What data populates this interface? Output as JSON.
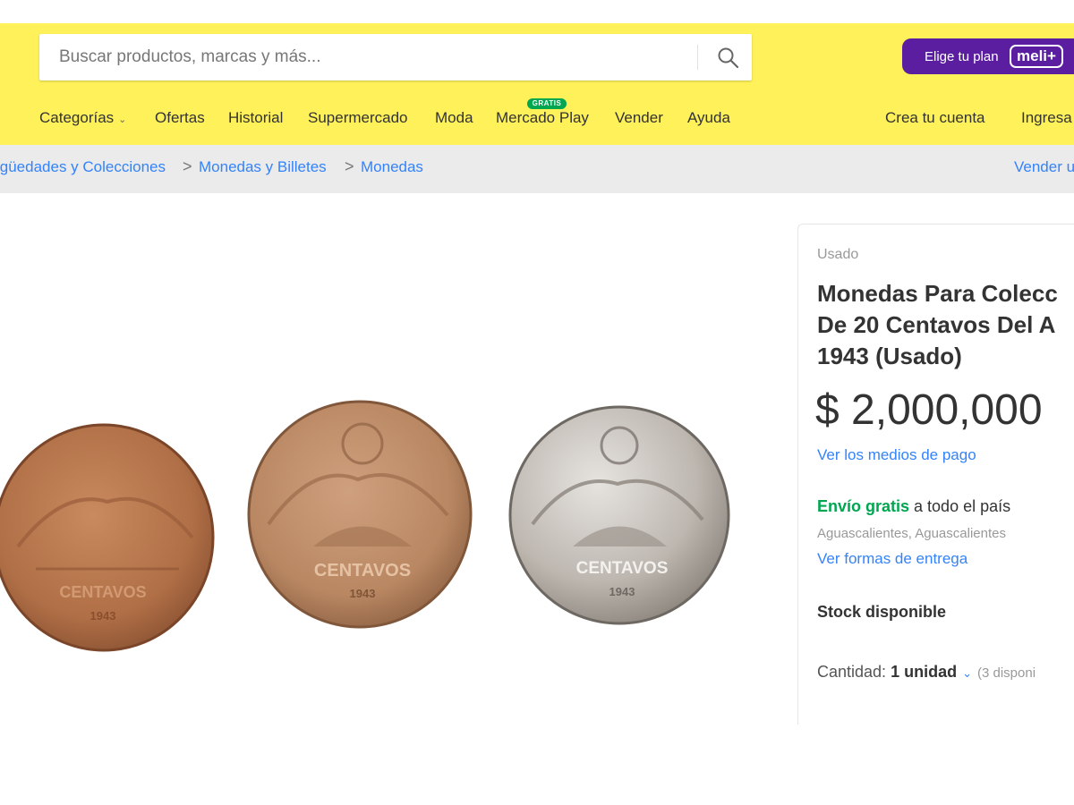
{
  "search": {
    "placeholder": "Buscar productos, marcas y más..."
  },
  "plan": {
    "label": "Elige tu plan",
    "badge": "meli+"
  },
  "nav": {
    "categories": "Categorías",
    "offers": "Ofertas",
    "history": "Historial",
    "supermarket": "Supermercado",
    "fashion": "Moda",
    "mercado_play": "Mercado Play",
    "mercado_play_badge": "GRATIS",
    "sell": "Vender",
    "help": "Ayuda",
    "create_account": "Crea tu cuenta",
    "login": "Ingresa"
  },
  "breadcrumb": {
    "items": [
      "igüedades y Colecciones",
      "Monedas y Billetes",
      "Monedas"
    ],
    "separator": ">",
    "sell_link": "Vender u"
  },
  "product": {
    "condition": "Usado",
    "title_lines": [
      "Monedas Para Colecc",
      "De 20 Centavos Del A",
      "1943 (Usado)"
    ],
    "price": "$ 2,000,000",
    "payment_link": "Ver los medios de pago",
    "shipping_highlight": "Envío gratis",
    "shipping_rest": " a todo el país",
    "location": "Aguascalientes, Aguascalientes",
    "delivery_link": "Ver formas de entrega",
    "stock": "Stock disponible",
    "quantity_label": "Cantidad:",
    "quantity_value": "1 unidad",
    "quantity_available": "(3 disponi"
  },
  "coins": [
    {
      "name": "coin-1",
      "text": "CENTAVOS",
      "year": "1943"
    },
    {
      "name": "coin-2",
      "text": "CENTAVOS",
      "year": "1943"
    },
    {
      "name": "coin-3",
      "text": "CENTAVOS",
      "year": "1943"
    }
  ],
  "colors": {
    "header": "#fff159",
    "link": "#3483fa",
    "green": "#00a650",
    "plan": "#5b1ea1",
    "breadcrumb_bg": "#ebebeb"
  }
}
